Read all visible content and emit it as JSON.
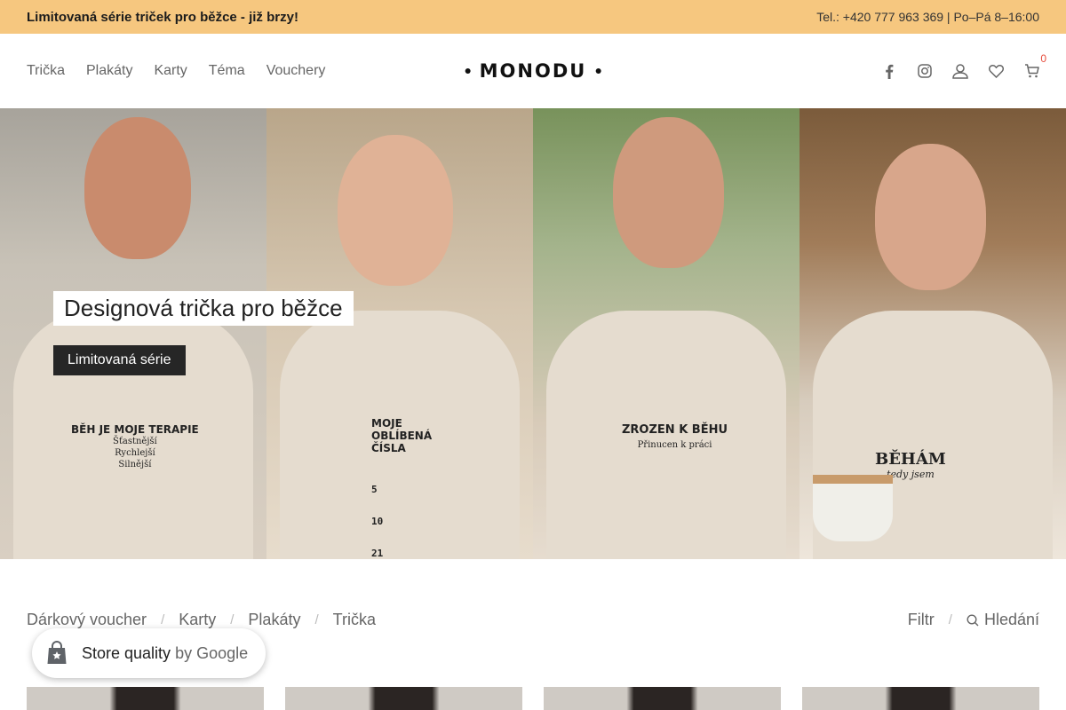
{
  "topbar": {
    "promo": "Limitovaná série triček pro běžce - již brzy!",
    "contact": "Tel.: +420 777 963 369 | Po–Pá 8–16:00"
  },
  "nav": {
    "items": [
      "Trička",
      "Plakáty",
      "Karty",
      "Téma",
      "Vouchery"
    ]
  },
  "logo": {
    "text": "MONODU"
  },
  "header_icons": {
    "facebook": "facebook-icon",
    "instagram": "instagram-icon",
    "account": "user-icon",
    "wishlist": "heart-icon",
    "cart": "cart-icon",
    "cart_count": "0"
  },
  "hero": {
    "title": "Designová trička pro běžce",
    "button": "Limitovaná série",
    "shirt_prints": {
      "p1_main": "BĚH JE MOJE TERAPIE",
      "p1_lines": [
        "Šťastnější",
        "Rychlejší",
        "Silnější"
      ],
      "p2_main": "MOJE OBLÍBENÁ ČÍSLA",
      "p2_numbers": [
        "5",
        "10",
        "21"
      ],
      "p3_main": "ZROZEN K BĚHU",
      "p3_sub": "Přinucen k práci",
      "p4_main": "BĚHÁM",
      "p4_sub": "tedy jsem"
    }
  },
  "categories": [
    "Dárkový voucher",
    "Karty",
    "Plakáty",
    "Trička"
  ],
  "tools": {
    "filter": "Filtr",
    "search": "Hledání"
  },
  "badge": {
    "label": "Store quality",
    "by": "by Google"
  },
  "colors": {
    "topbar": "#f6c77f",
    "button": "#262626",
    "cart_count": "#e74c3c"
  }
}
